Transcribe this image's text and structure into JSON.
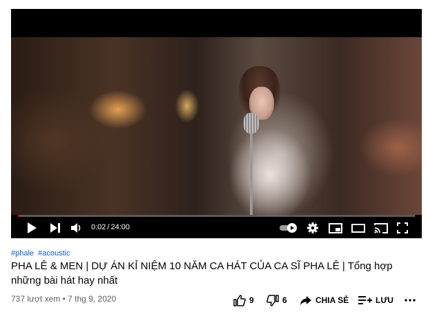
{
  "player": {
    "current_time": "0:02",
    "separator": "/",
    "duration": "24:00",
    "progress_fraction": 0.0014
  },
  "hashtags": [
    "#phale",
    "#acoustic"
  ],
  "video_title": "PHA LÊ & MEN | DỰ ÁN KỈ NIỆM 10 NĂM CA HÁT CỦA CA SĨ PHA LÊ | Tổng hợp những bài hát hay nhất",
  "meta": {
    "views": "737 lượt xem",
    "dot": "•",
    "date": "7 thg 9, 2020"
  },
  "actions": {
    "like_count": "9",
    "dislike_count": "6",
    "share_label": "CHIA SẺ",
    "save_label": "LƯU"
  },
  "colors": {
    "accent": "#ff0000",
    "link": "#065fd4",
    "text": "#030303",
    "secondary_text": "#606060"
  },
  "icons": {
    "play": "play-icon",
    "next": "next-icon",
    "volume": "volume-icon",
    "autoplay": "autoplay-toggle-icon",
    "settings": "gear-icon",
    "miniplayer": "miniplayer-icon",
    "theater": "theater-mode-icon",
    "cast": "cast-icon",
    "fullscreen": "fullscreen-icon",
    "like": "thumbs-up-icon",
    "dislike": "thumbs-down-icon",
    "share": "share-icon",
    "save": "playlist-add-icon",
    "more": "more-icon"
  }
}
